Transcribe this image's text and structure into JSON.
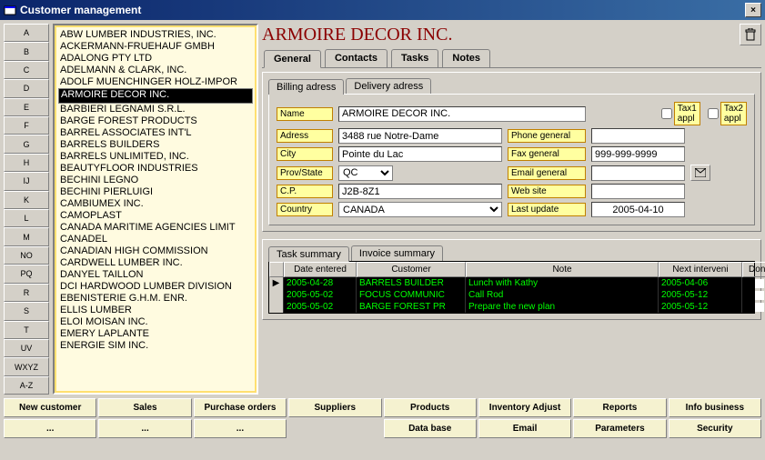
{
  "window": {
    "title": "Customer management"
  },
  "alpha": [
    "A",
    "B",
    "C",
    "D",
    "E",
    "F",
    "G",
    "H",
    "IJ",
    "K",
    "L",
    "M",
    "NO",
    "PQ",
    "R",
    "S",
    "T",
    "UV",
    "WXYZ",
    "A-Z"
  ],
  "customers": [
    "ABW LUMBER INDUSTRIES, INC.",
    "ACKERMANN-FRUEHAUF GMBH",
    "ADALONG PTY LTD",
    "ADELMANN & CLARK, INC.",
    "ADOLF MUENCHINGER HOLZ-IMPOR",
    "ARMOIRE DECOR INC.",
    "BARBIERI LEGNAMI S.R.L.",
    "BARGE FOREST PRODUCTS",
    "BARREL ASSOCIATES INT'L",
    "BARRELS BUILDERS",
    "BARRELS UNLIMITED, INC.",
    "BEAUTYFLOOR INDUSTRIES",
    "BECHINI LEGNO",
    "BECHINI PIERLUIGI",
    "CAMBIUMEX INC.",
    "CAMOPLAST",
    "CANADA MARITIME AGENCIES LIMIT",
    "CANADEL",
    "CANADIAN HIGH COMMISSION",
    "CARDWELL LUMBER INC.",
    "DANYEL TAILLON",
    "DCI HARDWOOD LUMBER DIVISION",
    "EBENISTERIE G.H.M. ENR.",
    "ELLIS LUMBER",
    "ELOI MOISAN INC.",
    "EMERY LAPLANTE",
    "ENERGIE SIM INC."
  ],
  "selectedIndex": 5,
  "companyTitle": "ARMOIRE DECOR INC.",
  "tabs": [
    "General",
    "Contacts",
    "Tasks",
    "Notes"
  ],
  "subtabs": [
    "Billing adress",
    "Delivery adress"
  ],
  "form": {
    "labels": {
      "name": "Name",
      "adress": "Adress",
      "city": "City",
      "provstate": "Prov/State",
      "cp": "C.P.",
      "country": "Country",
      "phone": "Phone general",
      "fax": "Fax general",
      "email": "Email general",
      "web": "Web site",
      "last": "Last update",
      "tax1": "Tax1 appl",
      "tax2": "Tax2 appl"
    },
    "values": {
      "name": "ARMOIRE DECOR INC.",
      "adress": "3488 rue Notre-Dame",
      "city": "Pointe du Lac",
      "provstate": "QC",
      "cp": "J2B-8Z1",
      "country": "CANADA",
      "phone": "",
      "fax": "999-999-9999",
      "email": "",
      "web": "",
      "last": "2005-04-10"
    }
  },
  "summaryTabs": [
    "Task summary",
    "Invoice summary"
  ],
  "grid": {
    "headers": [
      "",
      "Date entered",
      "Customer",
      "Note",
      "Next interveni",
      "Done"
    ],
    "rows": [
      {
        "date": "2005-04-28",
        "cust": "BARRELS BUILDER",
        "note": "Lunch with Kathy",
        "next": "2005-04-06"
      },
      {
        "date": "2005-05-02",
        "cust": "FOCUS COMMUNIC",
        "note": "Call Rod",
        "next": "2005-05-12"
      },
      {
        "date": "2005-05-02",
        "cust": "BARGE FOREST PR",
        "note": "Prepare the new plan",
        "next": "2005-05-12"
      }
    ]
  },
  "bottom": {
    "row1": [
      "New customer",
      "Sales",
      "Purchase orders",
      "Suppliers",
      "Products",
      "Inventory Adjust",
      "Reports",
      "Info business"
    ],
    "row2": [
      "...",
      "...",
      "...",
      "",
      "Data base",
      "Email",
      "Parameters",
      "Security"
    ]
  }
}
